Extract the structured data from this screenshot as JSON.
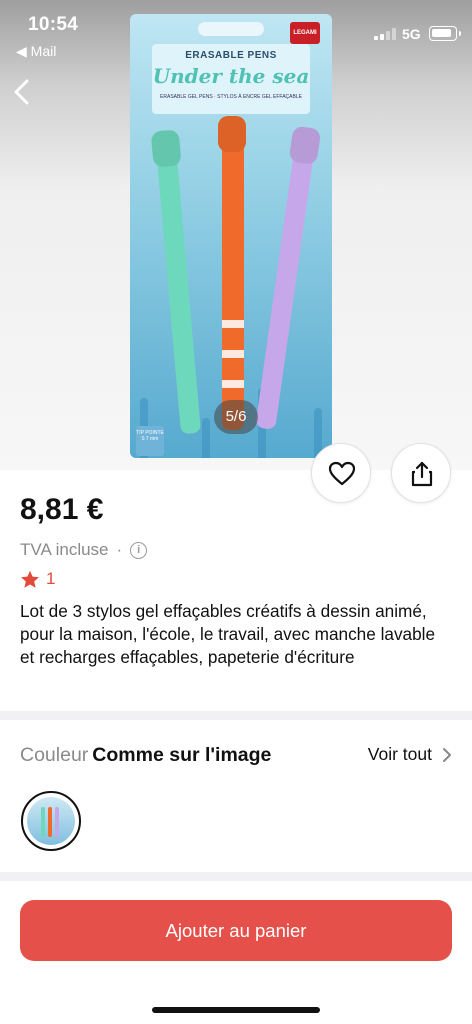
{
  "status_bar": {
    "time": "10:54",
    "back_app": "◀ Mail",
    "network": "5G"
  },
  "gallery": {
    "page_counter": "5/6",
    "package": {
      "brand": "LEGAMI",
      "title": "ERASABLE PENS",
      "subtitle": "Under the sea",
      "small_text": "ERASABLE GEL PENS · STYLOS À ENCRE GEL EFFAÇABLE",
      "tip_label": "TIP POINTE 0.7 mm"
    }
  },
  "product": {
    "price": "8,81 €",
    "tax_label": "TVA incluse",
    "tax_separator": "·",
    "rating": "1",
    "description": "Lot de 3 stylos gel effaçables créatifs à dessin animé, pour la maison, l'école, le travail, avec manche lavable et recharges effaçables, papeterie d'écriture"
  },
  "variant": {
    "label": "Couleur",
    "value": "Comme sur l'image",
    "see_all": "Voir tout"
  },
  "cta": {
    "add_to_cart": "Ajouter au panier"
  },
  "colors": {
    "accent": "#e5504a",
    "star": "#e34a3c"
  }
}
